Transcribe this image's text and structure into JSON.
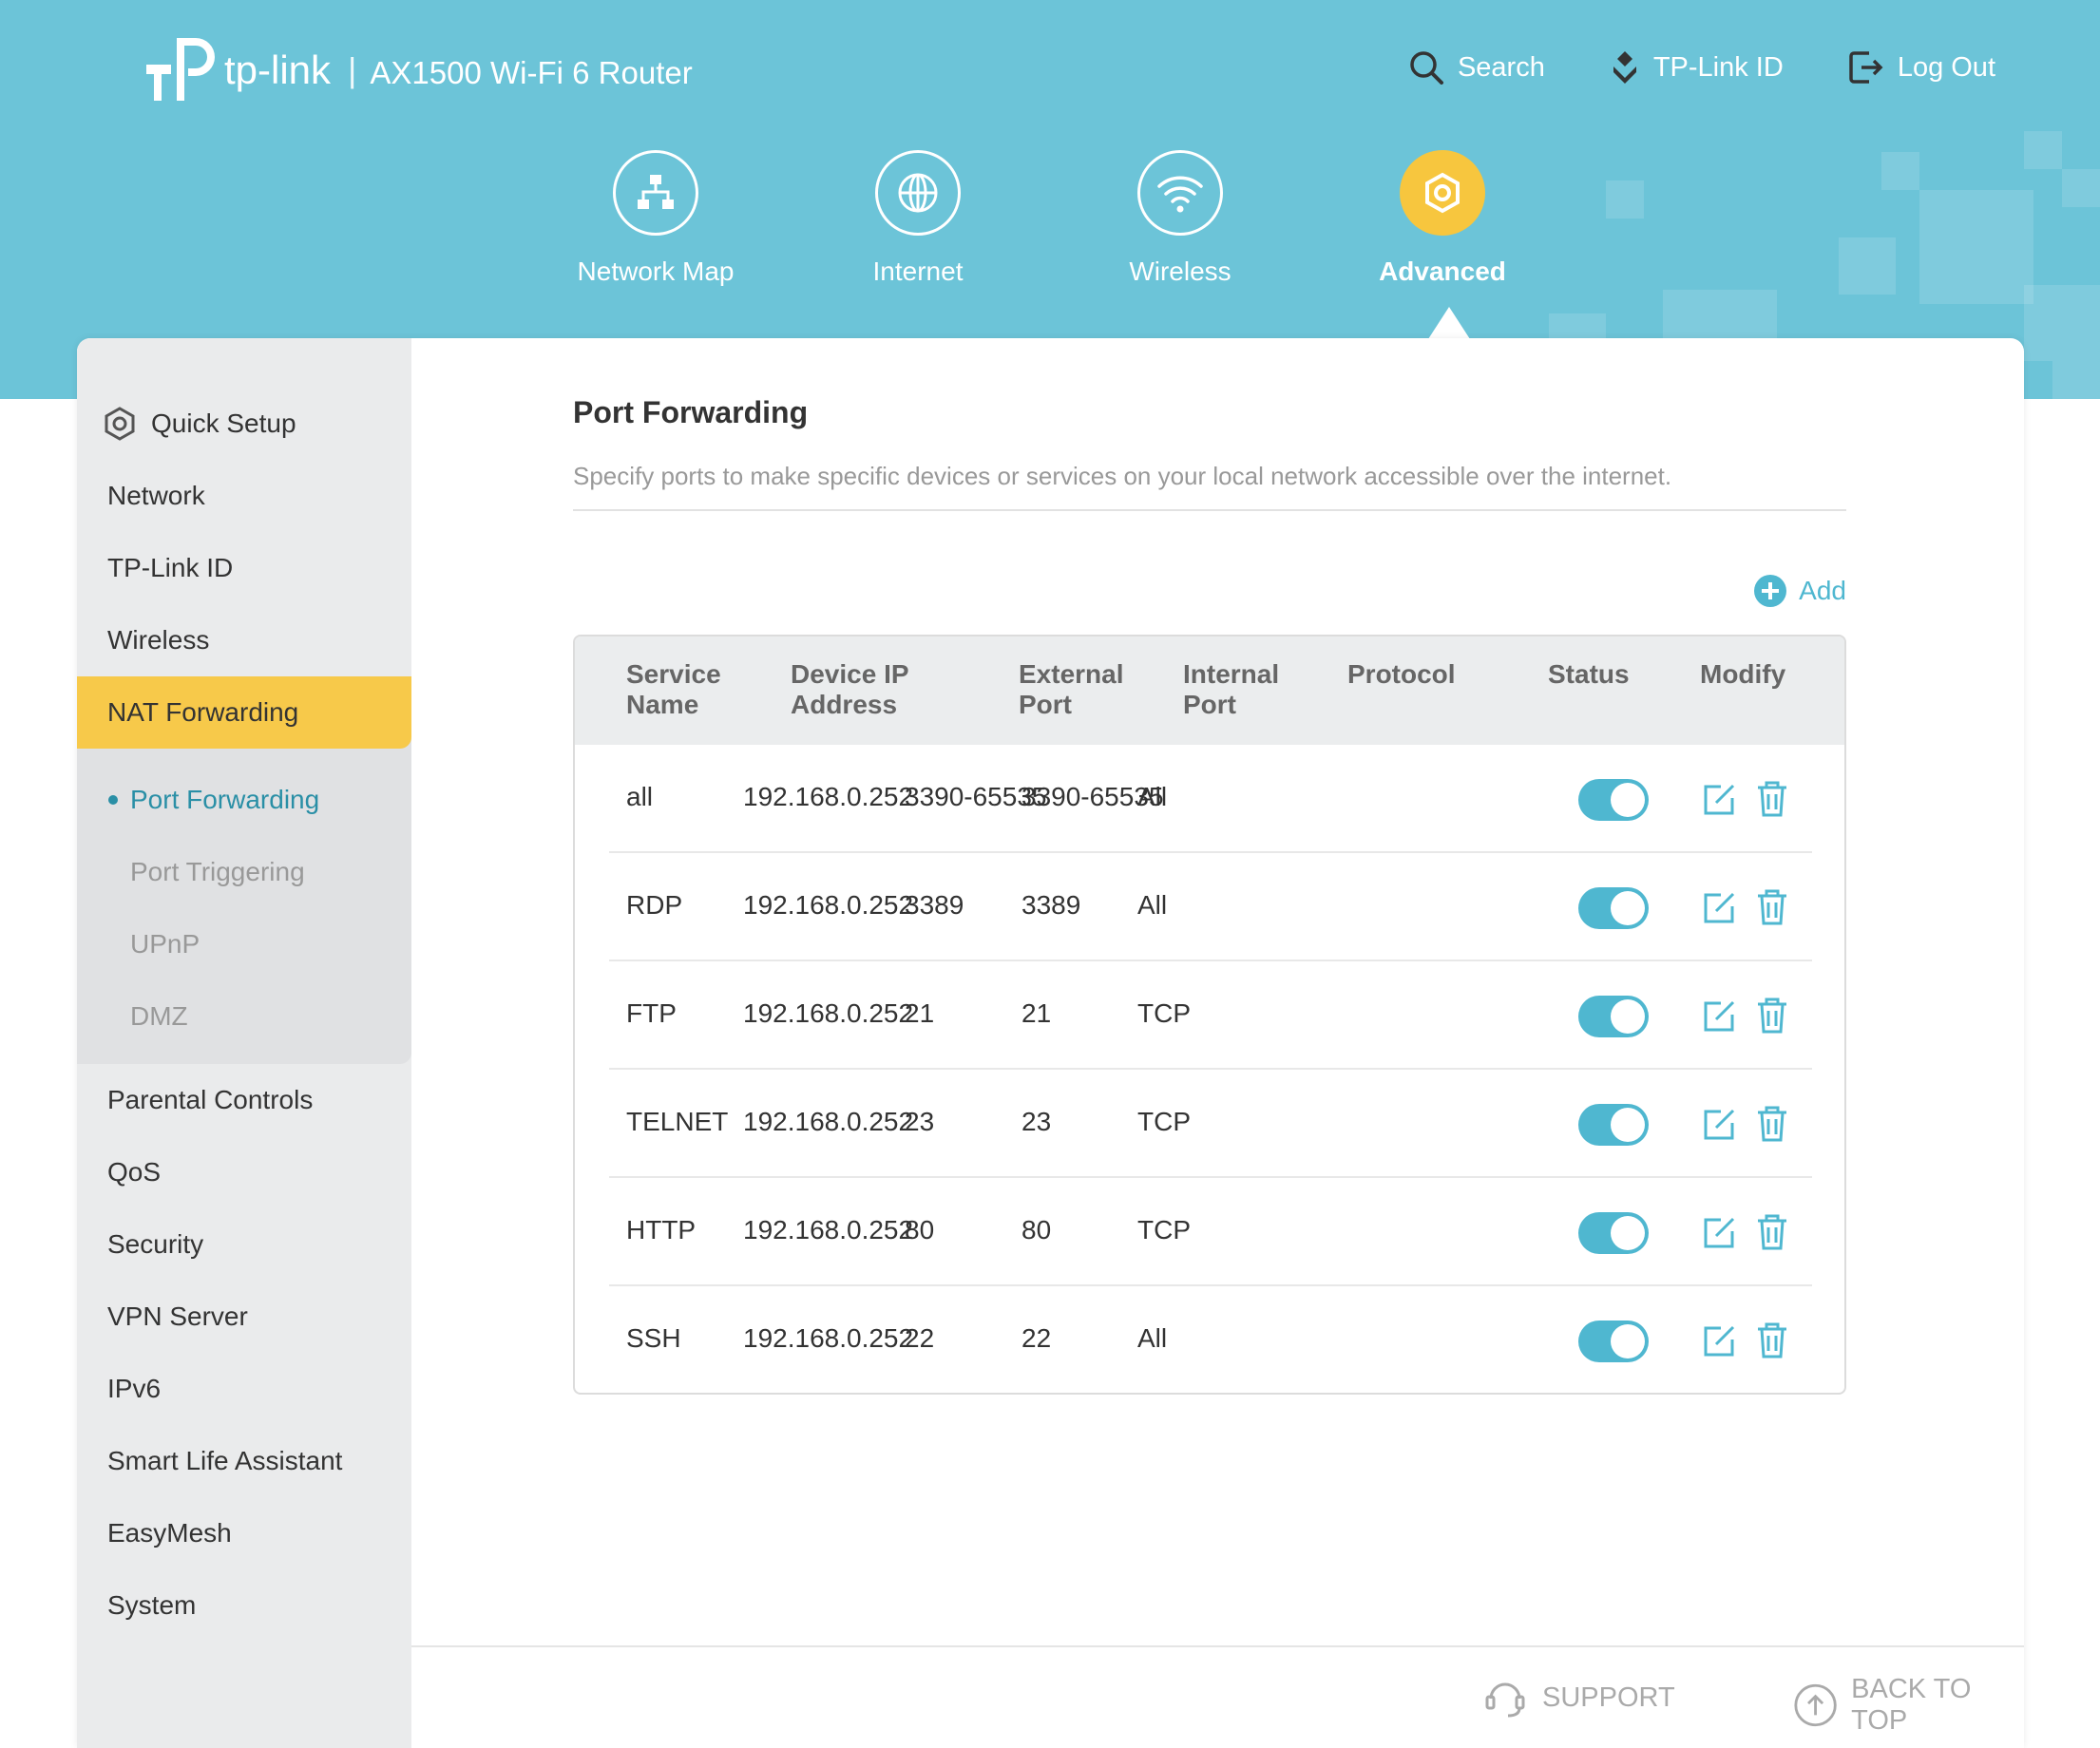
{
  "brand": {
    "name": "tp-link",
    "separator": "|",
    "model": "AX1500 Wi-Fi 6 Router"
  },
  "top_links": {
    "search": "Search",
    "tplink_id": "TP-Link ID",
    "logout": "Log Out"
  },
  "main_nav": [
    {
      "label": "Network Map",
      "icon": "network-map-icon"
    },
    {
      "label": "Internet",
      "icon": "globe-icon"
    },
    {
      "label": "Wireless",
      "icon": "wifi-icon"
    },
    {
      "label": "Advanced",
      "icon": "gear-icon",
      "active": true
    }
  ],
  "sidebar": {
    "items_top": [
      "Quick Setup",
      "Network",
      "TP-Link ID",
      "Wireless",
      "NAT Forwarding"
    ],
    "sub_items": [
      "Port Forwarding",
      "Port Triggering",
      "UPnP",
      "DMZ"
    ],
    "items_bottom": [
      "Parental Controls",
      "QoS",
      "Security",
      "VPN Server",
      "IPv6",
      "Smart Life Assistant",
      "EasyMesh",
      "System"
    ]
  },
  "page": {
    "title": "Port Forwarding",
    "description": "Specify ports to make specific devices or services on your local network accessible over the internet.",
    "add_label": "Add"
  },
  "table": {
    "headers": {
      "service_l1": "Service",
      "service_l2": "Name",
      "device_l1": "Device IP",
      "device_l2": "Address",
      "external_l1": "External",
      "external_l2": "Port",
      "internal_l1": "Internal",
      "internal_l2": "Port",
      "protocol": "Protocol",
      "status": "Status",
      "modify": "Modify"
    },
    "rows": [
      {
        "service": "all",
        "ip": "192.168.0.252",
        "external": "3390-65535",
        "internal": "3390-65535",
        "protocol": "All",
        "status": "on"
      },
      {
        "service": "RDP",
        "ip": "192.168.0.252",
        "external": "3389",
        "internal": "3389",
        "protocol": "All",
        "status": "on"
      },
      {
        "service": "FTP",
        "ip": "192.168.0.252",
        "external": "21",
        "internal": "21",
        "protocol": "TCP",
        "status": "on"
      },
      {
        "service": "TELNET",
        "ip": "192.168.0.252",
        "external": "23",
        "internal": "23",
        "protocol": "TCP",
        "status": "on"
      },
      {
        "service": "HTTP",
        "ip": "192.168.0.252",
        "external": "80",
        "internal": "80",
        "protocol": "TCP",
        "status": "on"
      },
      {
        "service": "SSH",
        "ip": "192.168.0.252",
        "external": "22",
        "internal": "22",
        "protocol": "All",
        "status": "on"
      }
    ]
  },
  "footer": {
    "support": "SUPPORT",
    "back_to_top": "BACK TO TOP"
  },
  "colors": {
    "header_bg": "#6cc4d8",
    "accent": "#4fb7d0",
    "active_yellow": "#f7c94a",
    "sidebar_bg": "#eaebec"
  }
}
